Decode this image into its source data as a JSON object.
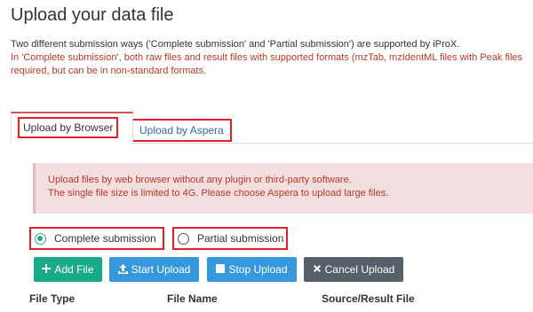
{
  "page": {
    "title": "Upload your data file",
    "intro": "Two different submission ways ('Complete submission' and 'Partial submission') are supported by iProX.",
    "note_line1": "In 'Complete submission', both raw files and result files with supported formats (mzTab, mzIdentML files with Peak files",
    "note_line2": "required, but can be in non-standard formats."
  },
  "tabs": {
    "browser": "Upload by Browser",
    "aspera": "Upload by Aspera"
  },
  "info": {
    "line1": "Upload files by web browser without any plugin or third-party software.",
    "line2": "The single file size is limited to 4G. Please choose Aspera to upload large files."
  },
  "radios": {
    "complete": "Complete submission",
    "partial": "Partial submission",
    "selected": "complete"
  },
  "buttons": {
    "add": "Add File",
    "start": "Start Upload",
    "stop": "Stop Upload",
    "cancel": "Cancel Upload"
  },
  "icons": {
    "add": "plus-icon",
    "start": "upload-icon",
    "stop": "stop-icon",
    "cancel": "times-icon"
  },
  "table": {
    "columns": [
      "File Type",
      "File Name",
      "Source/Result File"
    ]
  },
  "colors": {
    "accent_red": "#e31e24",
    "note_red": "#b13a2a",
    "teal": "#1aaa8a",
    "blue": "#3498db",
    "dark_gray": "#56606b",
    "link_blue": "#2d6ca2"
  }
}
